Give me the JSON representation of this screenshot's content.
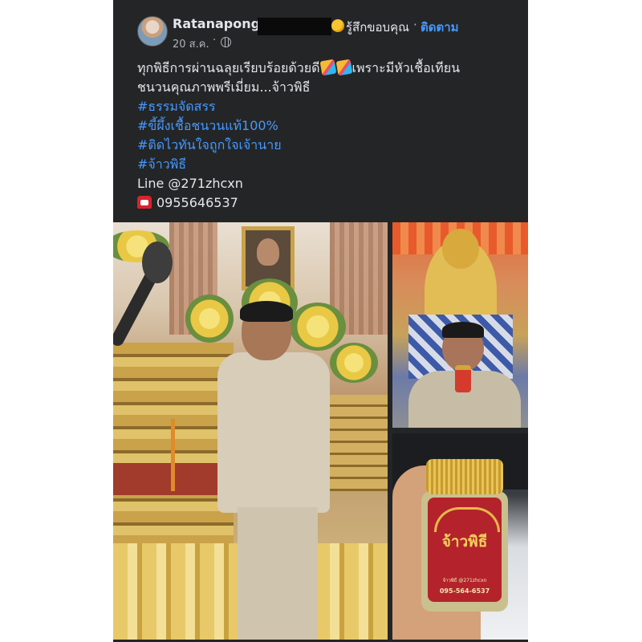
{
  "post": {
    "author": "Ratanapong",
    "feeling": "รู้สึกขอบคุณ",
    "separator": "·",
    "follow_label": "ติดตาม",
    "date": "20 ส.ค.",
    "dot": "·",
    "audience_icon": "globe-icon",
    "text_line1": "ทุกพิธีการผ่านฉลุยเรียบร้อยด้วยดี",
    "text_line1b": "เพราะมีหัวเชื้อเทียน",
    "text_line2": "ชนวนคุณภาพพรีเมี่ยม...จ้าวพิธี",
    "hashtags": [
      "#ธรรมจัดสรร",
      "#ขี้ผึ้งเชื้อชนวนแท้100%",
      "#ติดไวทันใจถูกใจเจ้านาย",
      "#จ้าวพิธี"
    ],
    "line_contact": "Line @271zhcxn",
    "phone": "0955646537"
  },
  "jar_label": {
    "brand": "จ้าวพิธี",
    "small_line": "จ้าวพิธี  @271zhcxn",
    "phone": "095-564-6537"
  },
  "colors": {
    "card_bg": "#242526",
    "text": "#e4e6eb",
    "muted": "#b0b3b8",
    "link": "#4599ff"
  }
}
